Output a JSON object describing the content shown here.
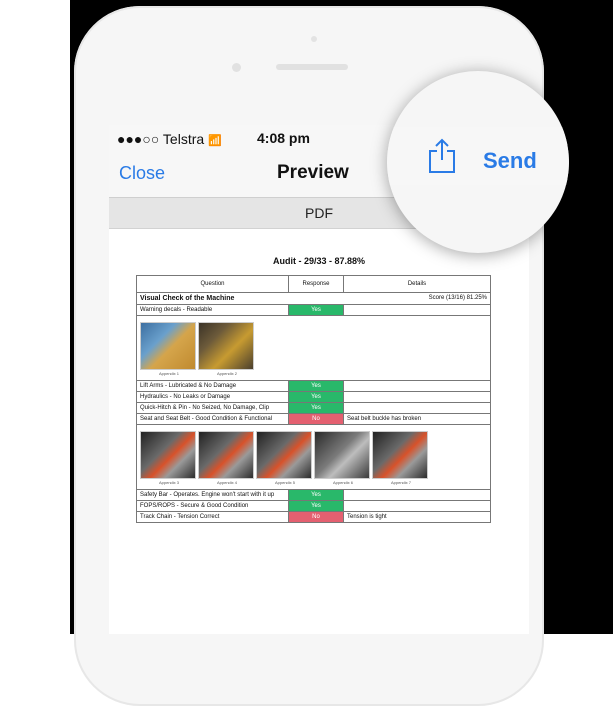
{
  "status": {
    "carrier": "●●●○○ Telstra",
    "wifi_icon": "wifi-icon",
    "time": "4:08 pm"
  },
  "nav": {
    "close": "Close",
    "title": "Preview",
    "send": "Send",
    "share_icon": "share-icon"
  },
  "pdf_label": "PDF",
  "doc": {
    "title": "Audit - 29/33 - 87.88%",
    "headers": [
      "Question",
      "Response",
      "Details"
    ],
    "section": {
      "title": "Visual Check of the Machine",
      "score": "Score (13/16) 81.25%"
    },
    "rows": [
      {
        "q": "Warning decals - Readable",
        "r": "Yes",
        "d": ""
      },
      {
        "q": "Lift Arms - Lubricated & No Damage",
        "r": "Yes",
        "d": ""
      },
      {
        "q": "Hydraulics - No Leaks or Damage",
        "r": "Yes",
        "d": ""
      },
      {
        "q": "Quick-Hitch & Pin - No Seized, No Damage, Clip",
        "r": "Yes",
        "d": ""
      },
      {
        "q": "Seat and Seat Belt - Good Condition & Functional",
        "r": "No",
        "d": "Seat belt buckle has broken"
      },
      {
        "q": "Safety Bar - Operates. Engine won't start with it up",
        "r": "Yes",
        "d": ""
      },
      {
        "q": "FOPS/ROPS - Secure & Good Condition",
        "r": "Yes",
        "d": ""
      },
      {
        "q": "Track Chain - Tension Correct",
        "r": "No",
        "d": "Tension is tight"
      }
    ],
    "appendix_set_1": [
      "Appendix 1",
      "Appendix 2"
    ],
    "appendix_set_2": [
      "Appendix 3",
      "Appendix 4",
      "Appendix 5",
      "Appendix 6",
      "Appendix 7"
    ]
  },
  "colors": {
    "accent": "#2a7be6",
    "yes": "#29b86a",
    "no": "#e46070"
  }
}
